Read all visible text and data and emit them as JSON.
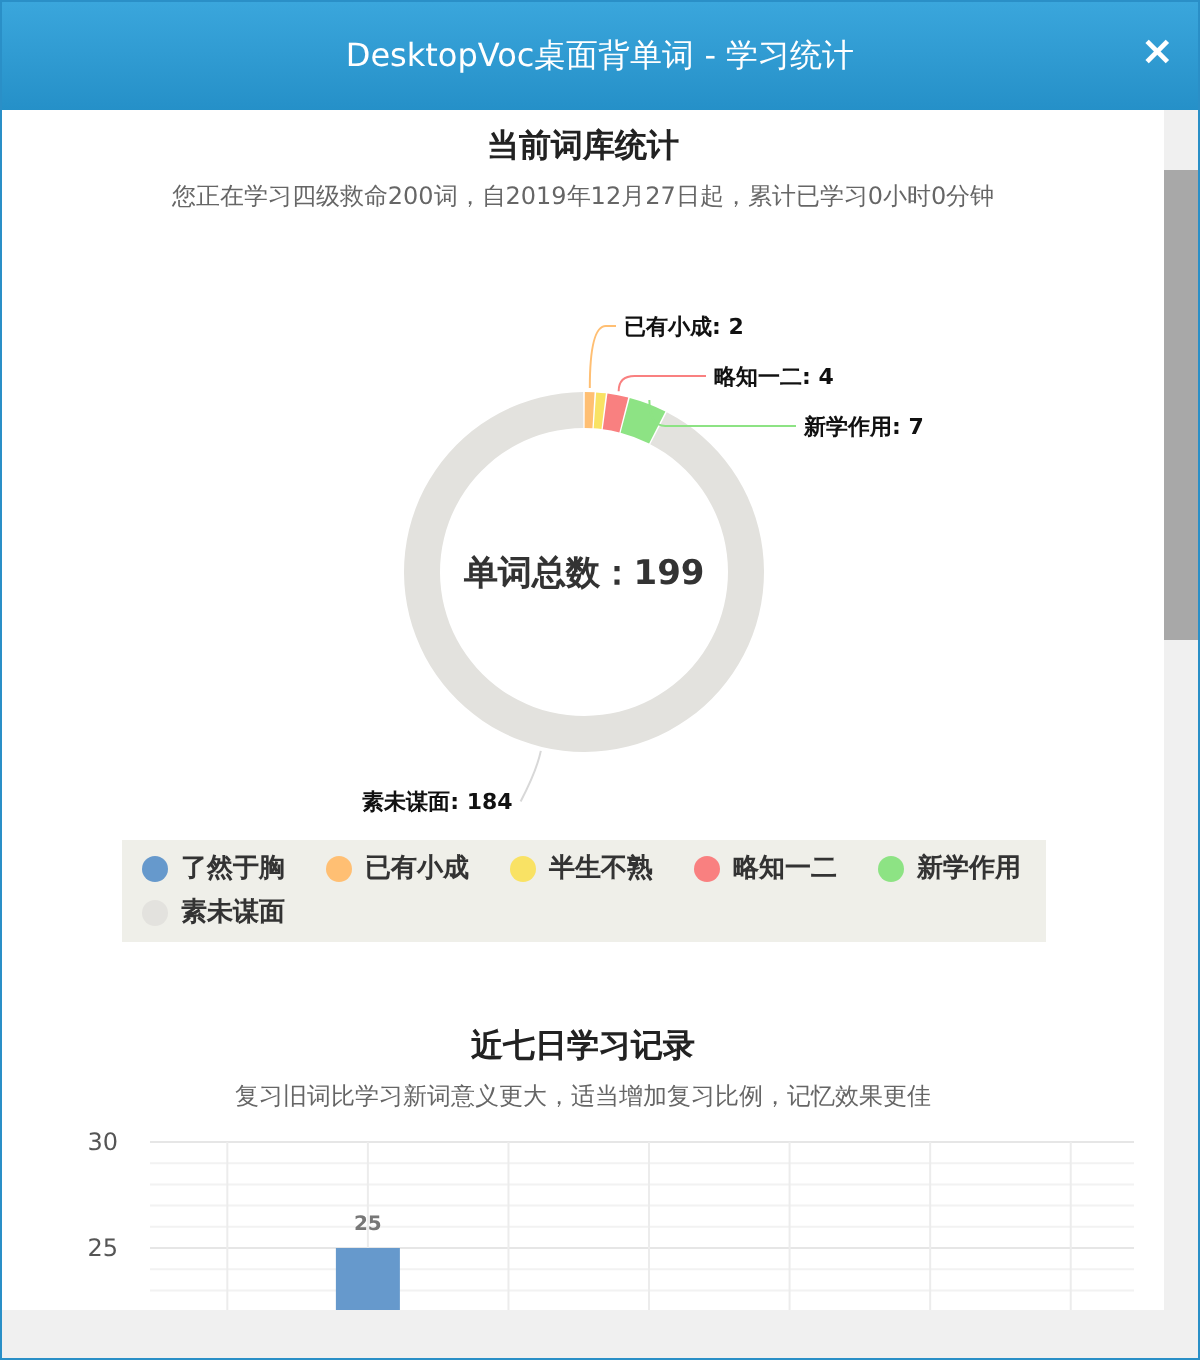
{
  "window": {
    "title": "DesktopVoc桌面背单词 - 学习统计",
    "close": "×"
  },
  "library": {
    "heading": "当前词库统计",
    "subtitle": "您正在学习四级救命200词，自2019年12月27日起，累计已学习0小时0分钟",
    "center_label": "单词总数：199",
    "chart_data": {
      "type": "donut",
      "categories": [
        "了然于胸",
        "已有小成",
        "半生不熟",
        "略知一二",
        "新学作用",
        "素未谋面"
      ],
      "values": [
        0,
        2,
        2,
        4,
        7,
        184
      ],
      "value_labels": [
        null,
        "已有小成: 2",
        null,
        "略知一二: 4",
        "新学作用: 7",
        "素未谋面: 184"
      ],
      "colors": [
        "#6699cc",
        "#ffbf73",
        "#f9e264",
        "#f98080",
        "#8de384",
        "#e3e2de"
      ]
    }
  },
  "recent": {
    "heading": "近七日学习记录",
    "subtitle": "复习旧词比学习新词意义更大，适当增加复习比例，记忆效果更佳",
    "chart_data": {
      "type": "bar",
      "ylim": [
        0,
        30
      ],
      "yticks": [
        25,
        30
      ],
      "data_labels": true,
      "series": [
        {
          "color": "#6699cc",
          "values": [
            null,
            25,
            null,
            null,
            null,
            null,
            null
          ]
        }
      ]
    }
  }
}
